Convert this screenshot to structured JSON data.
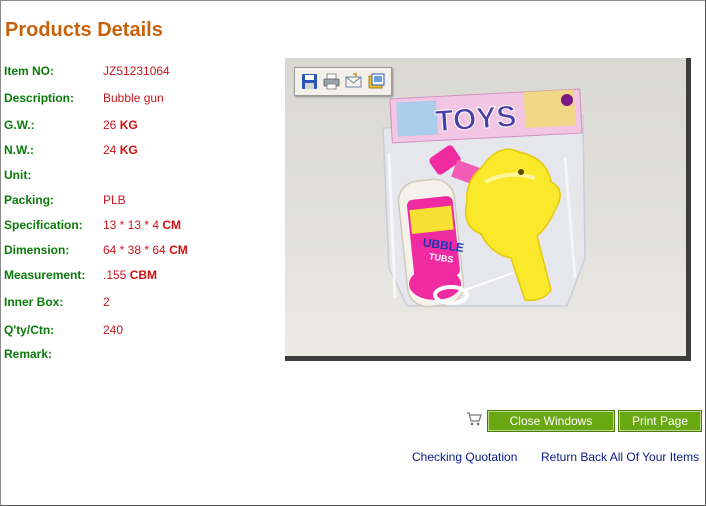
{
  "page": {
    "title": "Products Details"
  },
  "specs": [
    {
      "label": "Item NO:",
      "value": "JZ51231064",
      "unit": ""
    },
    {
      "label": "Description:",
      "value": "Bubble gun",
      "unit": ""
    },
    {
      "label": "G.W.:",
      "value": "26",
      "unit": "KG"
    },
    {
      "label": "N.W.:",
      "value": "24",
      "unit": "KG"
    },
    {
      "label": "Unit:",
      "value": "",
      "unit": ""
    },
    {
      "label": "Packing:",
      "value": "PLB",
      "unit": ""
    },
    {
      "label": "Specification:",
      "value": "13 * 13 * 4",
      "unit": "CM"
    },
    {
      "label": "Dimension:",
      "value": "64 * 38 * 64",
      "unit": "CM"
    },
    {
      "label": "Measurement:",
      "value": ".155",
      "unit": "CBM"
    },
    {
      "label": "Inner Box:",
      "value": "2",
      "unit": ""
    },
    {
      "label": "Q'ty/Ctn:",
      "value": "240",
      "unit": ""
    },
    {
      "label": "Remark:",
      "value": "",
      "unit": ""
    }
  ],
  "image_toolbar": {
    "icons": [
      "save-icon",
      "print-icon",
      "email-icon",
      "gallery-icon"
    ]
  },
  "product_image": {
    "package_text": "TOYS",
    "bottle_text_1": "UBBLE",
    "bottle_text_2": "TUBS"
  },
  "actions": {
    "close_label": "Close Windows",
    "print_label": "Print Page"
  },
  "links": {
    "checking": "Checking Quotation",
    "return": "Return Back All Of Your Items"
  }
}
